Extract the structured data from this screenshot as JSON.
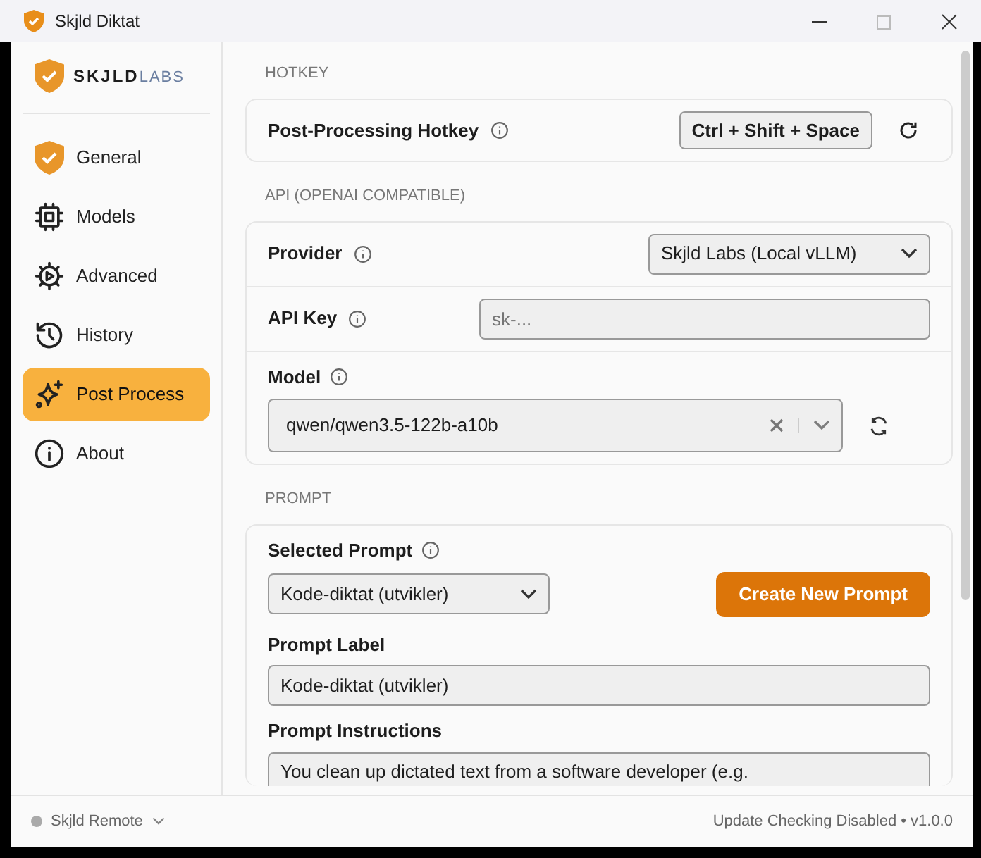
{
  "window": {
    "title": "Skjld Diktat"
  },
  "sidebar": {
    "logo": {
      "bold": "SKJLD",
      "light": "LABS"
    },
    "items": [
      {
        "label": "General",
        "selected": false
      },
      {
        "label": "Models",
        "selected": false
      },
      {
        "label": "Advanced",
        "selected": false
      },
      {
        "label": "History",
        "selected": false
      },
      {
        "label": "Post Process",
        "selected": true
      },
      {
        "label": "About",
        "selected": false
      }
    ]
  },
  "sections": [
    {
      "heading": "HOTKEY",
      "rows": [
        {
          "kind": "hotkey",
          "label": "Post-Processing Hotkey",
          "value": "Ctrl + Shift + Space"
        }
      ]
    },
    {
      "heading": "API (OPENAI COMPATIBLE)",
      "rows": [
        {
          "kind": "select",
          "label": "Provider",
          "value": "Skjld Labs (Local vLLM)"
        },
        {
          "kind": "input",
          "label": "API Key",
          "placeholder": "sk-..."
        },
        {
          "kind": "combo",
          "label": "Model",
          "value": "qwen/qwen3.5-122b-a10b"
        }
      ]
    },
    {
      "heading": "PROMPT",
      "prompt": {
        "selected_label": "Selected Prompt",
        "selected_value": "Kode-diktat (utvikler)",
        "create_button": "Create New Prompt",
        "label_label": "Prompt Label",
        "label_value": "Kode-diktat (utvikler)",
        "instructions_label": "Prompt Instructions",
        "instructions_value": "You clean up dictated text from a software developer (e.g."
      }
    }
  ],
  "status_bar": {
    "remote": "Skjld Remote",
    "connected": false,
    "update": "Update Checking Disabled • v1.0.0"
  }
}
